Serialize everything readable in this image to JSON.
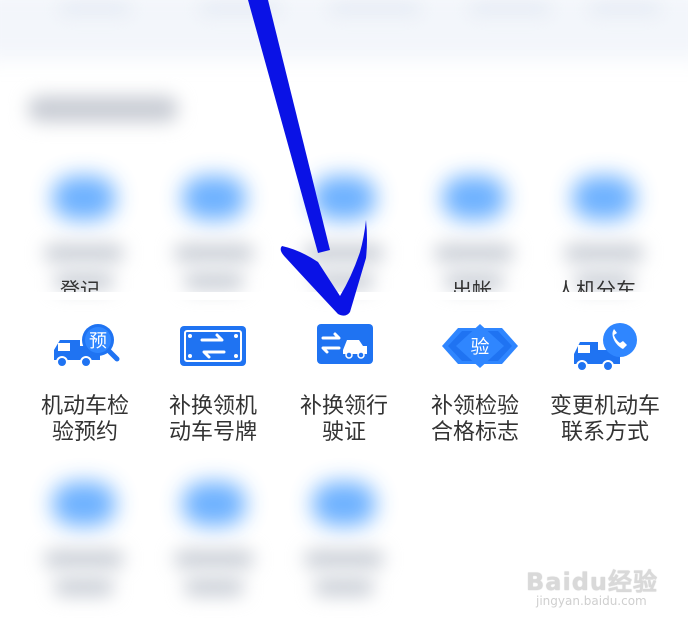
{
  "services": [
    {
      "id": "inspection-appointment",
      "lines": [
        "机动车检",
        "验预约"
      ],
      "icon": "car-magnifier-icon",
      "badge": "预"
    },
    {
      "id": "replace-plate",
      "lines": [
        "补换领机",
        "动车号牌"
      ],
      "icon": "license-plate-swap-icon"
    },
    {
      "id": "replace-license",
      "lines": [
        "补换领行",
        "驶证"
      ],
      "icon": "vehicle-license-swap-icon"
    },
    {
      "id": "inspection-mark",
      "lines": [
        "补领检验",
        "合格标志"
      ],
      "icon": "inspection-diamond-icon",
      "badge": "验"
    },
    {
      "id": "change-contact",
      "lines": [
        "变更机动车",
        "联系方式"
      ],
      "icon": "car-phone-icon"
    }
  ],
  "row_above_fragments": [
    "登记",
    "出帐",
    "人机分车"
  ],
  "colors": {
    "icon_blue": "#1f73f2",
    "icon_light": "#5ea9ff",
    "arrow_blue": "#0a12e6",
    "label": "#333333"
  },
  "watermark": {
    "brand": "Baidu经验",
    "url": "jingyan.baidu.com"
  }
}
